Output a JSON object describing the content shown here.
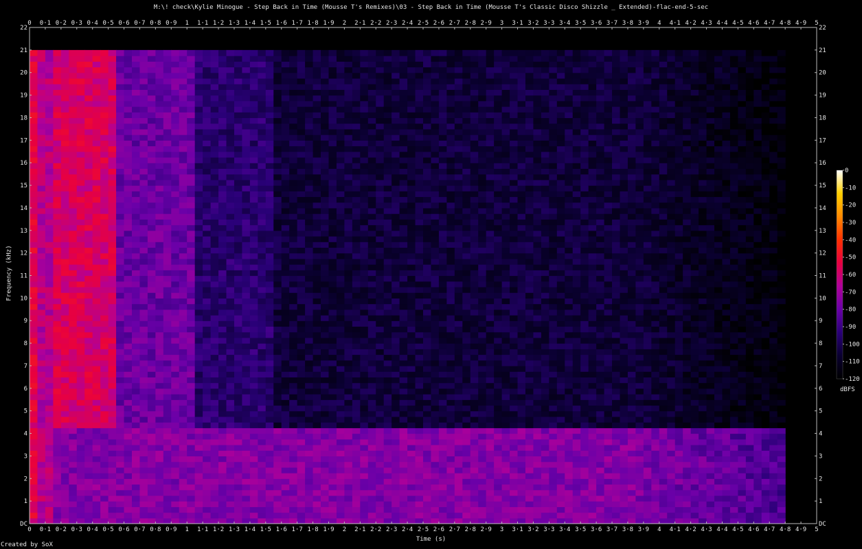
{
  "header": {
    "title": "M:\\! check\\Kylie Minogue - Step Back in Time (Mousse T's Remixes)\\03 - Step Back in Time (Mousse T's Classic Disco Shizzle _ Extended)-flac-end-5-sec"
  },
  "footer": {
    "credit": "Created by SoX"
  },
  "chart_data": {
    "type": "heatmap",
    "title": "M:\\! check\\Kylie Minogue - Step Back in Time (Mousse T's Remixes)\\03 - Step Back in Time (Mousse T's Classic Disco Shizzle _ Extended)-flac-end-5-sec",
    "xlabel": "Time (s)",
    "ylabel": "Frequency (kHz)",
    "xlim": [
      0,
      5
    ],
    "ylim": [
      0,
      22
    ],
    "x_ticks": [
      "0",
      "0·1",
      "0·2",
      "0·3",
      "0·4",
      "0·5",
      "0·6",
      "0·7",
      "0·8",
      "0·9",
      "1",
      "1·1",
      "1·2",
      "1·3",
      "1·4",
      "1·5",
      "1·6",
      "1·7",
      "1·8",
      "1·9",
      "2",
      "2·1",
      "2·2",
      "2·3",
      "2·4",
      "2·5",
      "2·6",
      "2·7",
      "2·8",
      "2·9",
      "3",
      "3·1",
      "3·2",
      "3·3",
      "3·4",
      "3·5",
      "3·6",
      "3·7",
      "3·8",
      "3·9",
      "4",
      "4·1",
      "4·2",
      "4·3",
      "4·4",
      "4·5",
      "4·6",
      "4·7",
      "4·8",
      "4·9",
      "5"
    ],
    "y_ticks": [
      "DC",
      "1",
      "2",
      "3",
      "4",
      "5",
      "6",
      "7",
      "8",
      "9",
      "10",
      "11",
      "12",
      "13",
      "14",
      "15",
      "16",
      "17",
      "18",
      "19",
      "20",
      "21",
      "22"
    ],
    "colorbar": {
      "label": "dBFS",
      "range": [
        -120,
        0
      ],
      "ticks": [
        "0",
        "-10",
        "-20",
        "-30",
        "-40",
        "-50",
        "-60",
        "-70",
        "-80",
        "-90",
        "-100",
        "-110",
        "-120"
      ]
    },
    "palette": [
      "#000000",
      "#0a0030",
      "#2a0078",
      "#6a00a8",
      "#b0009a",
      "#e80040",
      "#ff3000",
      "#ff8a00",
      "#ffd000",
      "#ffffff"
    ],
    "energy_regions": [
      {
        "t": [
          0.0,
          0.05
        ],
        "f": [
          0,
          21
        ],
        "dbfs": -55
      },
      {
        "t": [
          0.05,
          0.15
        ],
        "f": [
          0,
          21
        ],
        "dbfs": -65
      },
      {
        "t": [
          0.15,
          0.57
        ],
        "f": [
          4.3,
          21
        ],
        "dbfs": -58
      },
      {
        "t": [
          0.57,
          1.07
        ],
        "f": [
          4.3,
          21
        ],
        "dbfs": -80
      },
      {
        "t": [
          1.07,
          1.57
        ],
        "f": [
          4.3,
          21
        ],
        "dbfs": -95
      },
      {
        "t": [
          1.57,
          5.0
        ],
        "f": [
          4.3,
          21
        ],
        "dbfs": -105
      },
      {
        "t": [
          0.0,
          5.0
        ],
        "f": [
          0,
          4.3
        ],
        "dbfs": -75
      }
    ],
    "signal_end_s": 4.8
  }
}
